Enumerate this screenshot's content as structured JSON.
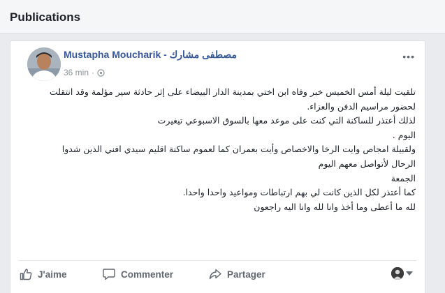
{
  "header": {
    "title": "Publications"
  },
  "post": {
    "author": "Mustapha Moucharik - مصطفى مشارك",
    "time": "36 min",
    "meta_separator": "·",
    "more_label": "•••",
    "lines": [
      "تلقيت ليلة أمس الخميس خبر وفاه ابن اختي بمدينة الدار البيضاء على إثر حادثة سير مؤلمة وقد انتقلت",
      "لحضور مراسيم الدفن والعزاء.",
      "لذلك أعتذر للساكنة التي كنت على موعد معها بالسوق الاسبوعي تيغيرت",
      "اليوم .",
      "ولقبيلة امجاص وايت الرخا والاخصاص وأيت بعمران كما لعموم ساكنة اقليم سيدي افني الذين شدوا",
      "الرحال لأتواصل معهم اليوم",
      "الجمعة",
      "كما أعتذر لكل الذين كانت لي بهم ارتباطات ومواعيد واحدا واحدا.",
      "لله ما أعطى وما أخذ وانا لله وانا اليه راجعون"
    ]
  },
  "actions": {
    "like": "J'aime",
    "comment": "Commenter",
    "share": "Partager"
  },
  "icons": {
    "globe": "globe-icon",
    "like": "thumbs-up-icon",
    "comment": "speech-bubble-icon",
    "share": "share-arrow-icon",
    "more": "ellipsis-icon",
    "caret": "caret-down-icon"
  },
  "colors": {
    "author_link": "#365899",
    "action_text": "#606770",
    "meta_text": "#90949c",
    "page_bg": "#e9ebee"
  }
}
